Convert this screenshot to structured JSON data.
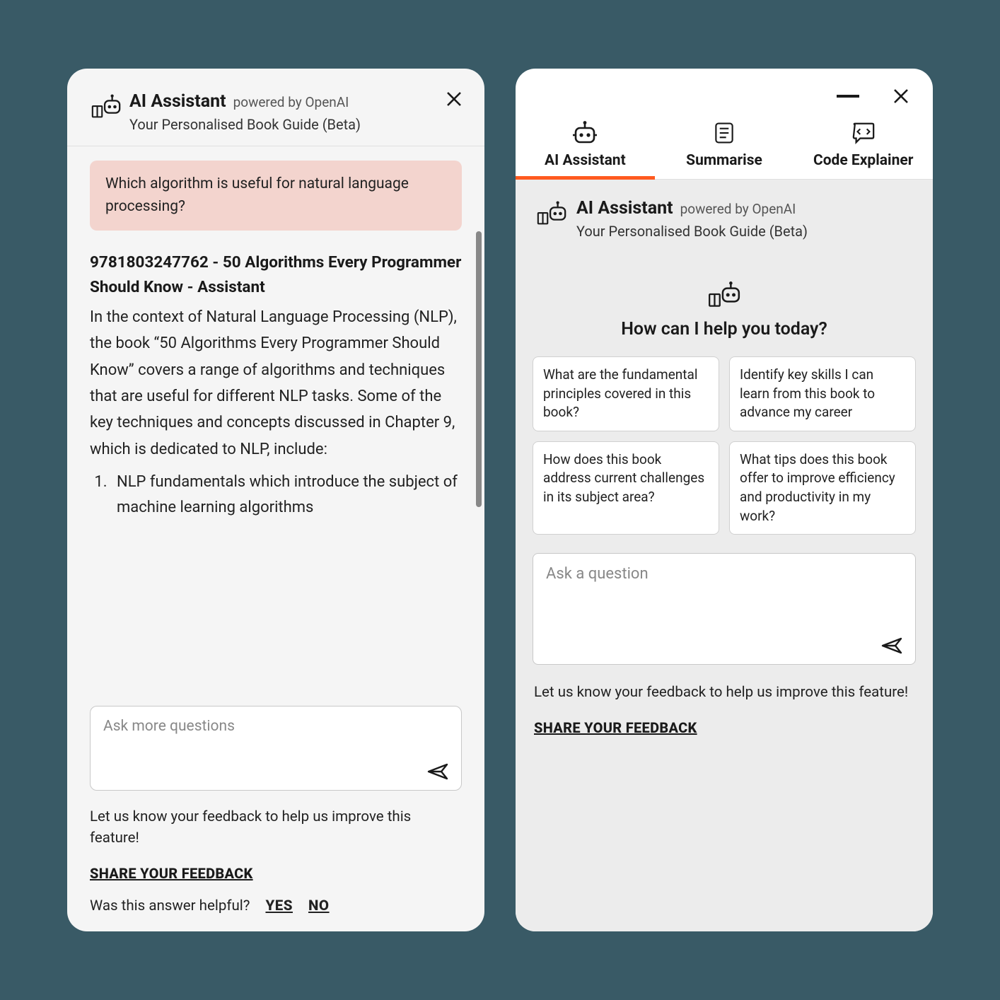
{
  "left": {
    "header": {
      "title": "AI Assistant",
      "powered": "powered by OpenAI",
      "subtitle": "Your Personalised Book Guide (Beta)"
    },
    "question": "Which algorithm is useful for natural language processing?",
    "answer": {
      "heading": "9781803247762 - 50 Algorithms Every Programmer Should Know - Assistant",
      "body": "In the context of Natural Language Processing (NLP), the book “50 Algorithms Every Programmer Should Know” covers a range of algorithms and techniques that are useful for different NLP tasks. Some of the key techniques and concepts discussed in Chapter 9, which is dedicated to NLP, include:",
      "list_item_1": "NLP fundamentals which introduce the subject of machine learning algorithms"
    },
    "input_placeholder": "Ask more questions",
    "feedback_text": "Let us know your feedback to help us improve this feature!",
    "share_link": "SHARE YOUR FEEDBACK",
    "helpful": {
      "prompt": "Was this answer helpful?",
      "yes": "YES",
      "no": "NO"
    }
  },
  "right": {
    "tabs": {
      "ai": "AI Assistant",
      "summarise": "Summarise",
      "code": "Code Explainer"
    },
    "header": {
      "title": "AI Assistant",
      "powered": "powered by OpenAI",
      "subtitle": "Your Personalised Book Guide (Beta)"
    },
    "help_title": "How can I help you today?",
    "suggestions": [
      "What are the fundamental principles covered in this book?",
      "Identify key skills I can learn from this book to advance my career",
      "How does this book address current challenges in its subject area?",
      "What tips does this book offer to improve efficiency and productivity in my work?"
    ],
    "input_placeholder": "Ask a question",
    "feedback_text": "Let us know your feedback to help us improve this feature!",
    "share_link": "SHARE YOUR FEEDBACK"
  }
}
